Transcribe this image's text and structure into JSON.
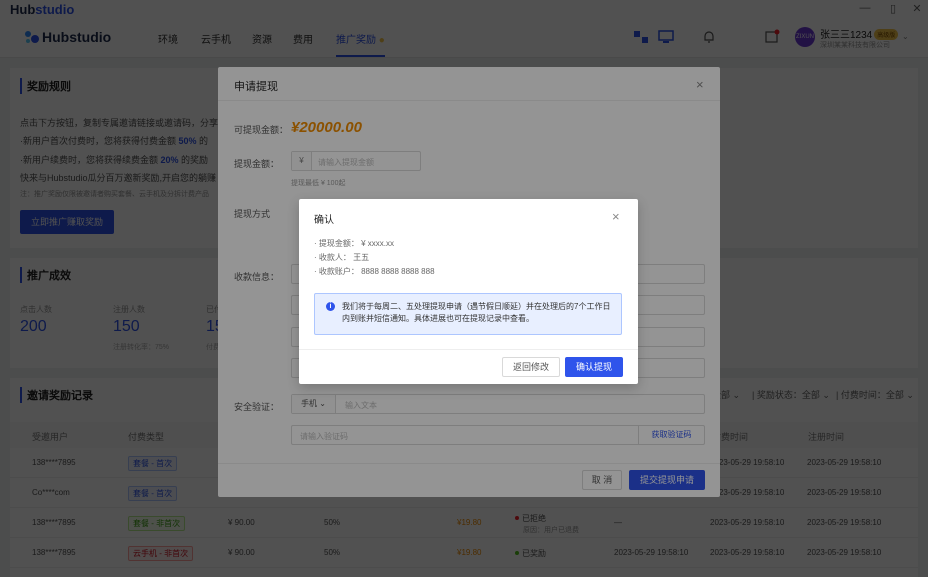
{
  "titlebar": {
    "app_prefix": "Hub",
    "app_suffix": "studio",
    "minimize": "—",
    "maximize": "▯"
  },
  "nav": {
    "brand": "Hubstudio",
    "items": [
      "环境",
      "云手机",
      "资源",
      "费用",
      "推广奖励"
    ],
    "user_name": "张三三1234",
    "user_badge": "高级版",
    "avatar_text": "ZIXUN",
    "company": "深圳某某科技有限公司"
  },
  "rules": {
    "title": "奖励规则",
    "line1": "点击下方按钮，复制专属邀请链接或邀请码，分享",
    "line2_a": "·新用户首次付费时，您将获得付费金额",
    "line2_hl": "50%",
    "line2_b": "的",
    "line3_a": "·新用户续费时，您将获得续费金额",
    "line3_hl": "20%",
    "line3_b": "的奖励",
    "line4": "快来与Hubstudio瓜分百万邀新奖励,开启您的躺赚",
    "note": "注：推广奖励仅限被邀请者购买套餐、云手机及分拆计费产品",
    "button": "立即推广赚取奖励"
  },
  "results": {
    "title": "推广成效",
    "stats": [
      {
        "label": "点击人数",
        "value": "200",
        "sub": ""
      },
      {
        "label": "注册人数",
        "value": "150",
        "sub": "注册转化率：75%"
      },
      {
        "label": "已付费人数",
        "value": "15",
        "sub": "付费转化率"
      }
    ]
  },
  "records": {
    "title": "邀请奖励记录",
    "filter_status_label": "奖励状态：",
    "filter_status_value": "全部",
    "filter_time_label": "付费时间：",
    "filter_time_value": "全部",
    "filter_type_value": "全部",
    "columns": [
      "受邀用户",
      "付费类型",
      "付费时间",
      "注册时间"
    ],
    "rows": [
      {
        "user": "138****7895",
        "type": "套餐 - 首次",
        "tag": "blue",
        "amount": "",
        "rate": "",
        "reward": "",
        "status": "",
        "status_sub": "",
        "pay_time": "2023-05-29 19:58:10",
        "reg_time": "2023-05-29 19:58:10"
      },
      {
        "user": "Co****com",
        "type": "套餐 - 首次",
        "tag": "blue",
        "amount": "",
        "rate": "",
        "reward": "",
        "status": "",
        "status_sub": "",
        "pay_time": "2023-05-29 19:58:10",
        "reg_time": "2023-05-29 19:58:10"
      },
      {
        "user": "138****7895",
        "type": "套餐 - 非首次",
        "tag": "green",
        "amount": "¥ 90.00",
        "rate": "50%",
        "reward": "¥19.80",
        "status": "已拒绝",
        "status_sub": "原因：用户已退费",
        "pay_time": "—",
        "reg_time": "2023-05-29 19:58:10"
      },
      {
        "user": "138****7895",
        "type": "云手机 - 非首次",
        "tag": "red",
        "amount": "¥ 90.00",
        "rate": "50%",
        "reward": "¥19.80",
        "status": "已奖励",
        "status_sub": "",
        "pay_time": "2023-05-29 19:58:10",
        "reg_time": "2023-05-29 19:58:10"
      }
    ]
  },
  "withdraw_modal": {
    "title": "申请提现",
    "available_label": "可提现金额：",
    "available_value": "¥20000.00",
    "amount_label": "提现金额：",
    "amount_prefix": "¥",
    "amount_placeholder": "请输入提现金额",
    "amount_hint": "提现最低 ¥ 100起",
    "method_label": "提现方式",
    "payee_label": "收款信息：",
    "security_label": "安全验证：",
    "verify_type": "手机",
    "verify_placeholder": "输入文本",
    "code_placeholder": "请输入验证码",
    "code_button": "获取验证码",
    "cancel": "取 消",
    "submit": "提交提现申请"
  },
  "confirm_dialog": {
    "title": "确认",
    "amount_line": "· 提现金额：  ¥  xxxx.xx",
    "payee_line": "· 收款人：  王五",
    "account_line": "· 收款账户：  8888 8888 8888 888",
    "notice": "我们将于每周二、五处理提现申请（遇节假日顺延）并在处理后的7个工作日内到账并短信通知。具体进展也可在提现记录中查看。",
    "back": "返回修改",
    "confirm": "确认提现"
  },
  "colors": {
    "primary": "#2f54eb",
    "amount": "#f08c00"
  }
}
